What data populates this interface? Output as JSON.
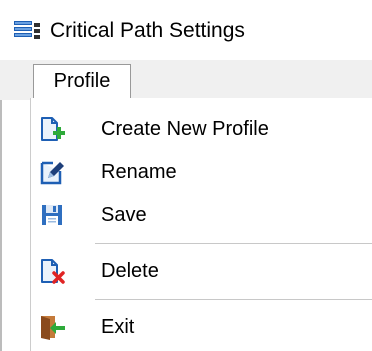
{
  "window": {
    "title": "Critical Path Settings",
    "app_icon": "settings-list-icon"
  },
  "menubar": {
    "items": [
      {
        "label": "Profile"
      }
    ]
  },
  "menu": {
    "items": [
      {
        "label": "Create New Profile",
        "icon": "create-profile-icon"
      },
      {
        "label": "Rename",
        "icon": "rename-icon"
      },
      {
        "label": "Save",
        "icon": "save-icon"
      },
      {
        "label": "Delete",
        "icon": "delete-icon"
      },
      {
        "label": "Exit",
        "icon": "exit-icon"
      }
    ]
  },
  "colors": {
    "accent_blue": "#1e5fb4",
    "add_green": "#2eaa3a",
    "delete_red": "#e02424",
    "door_brown": "#a0522d"
  }
}
